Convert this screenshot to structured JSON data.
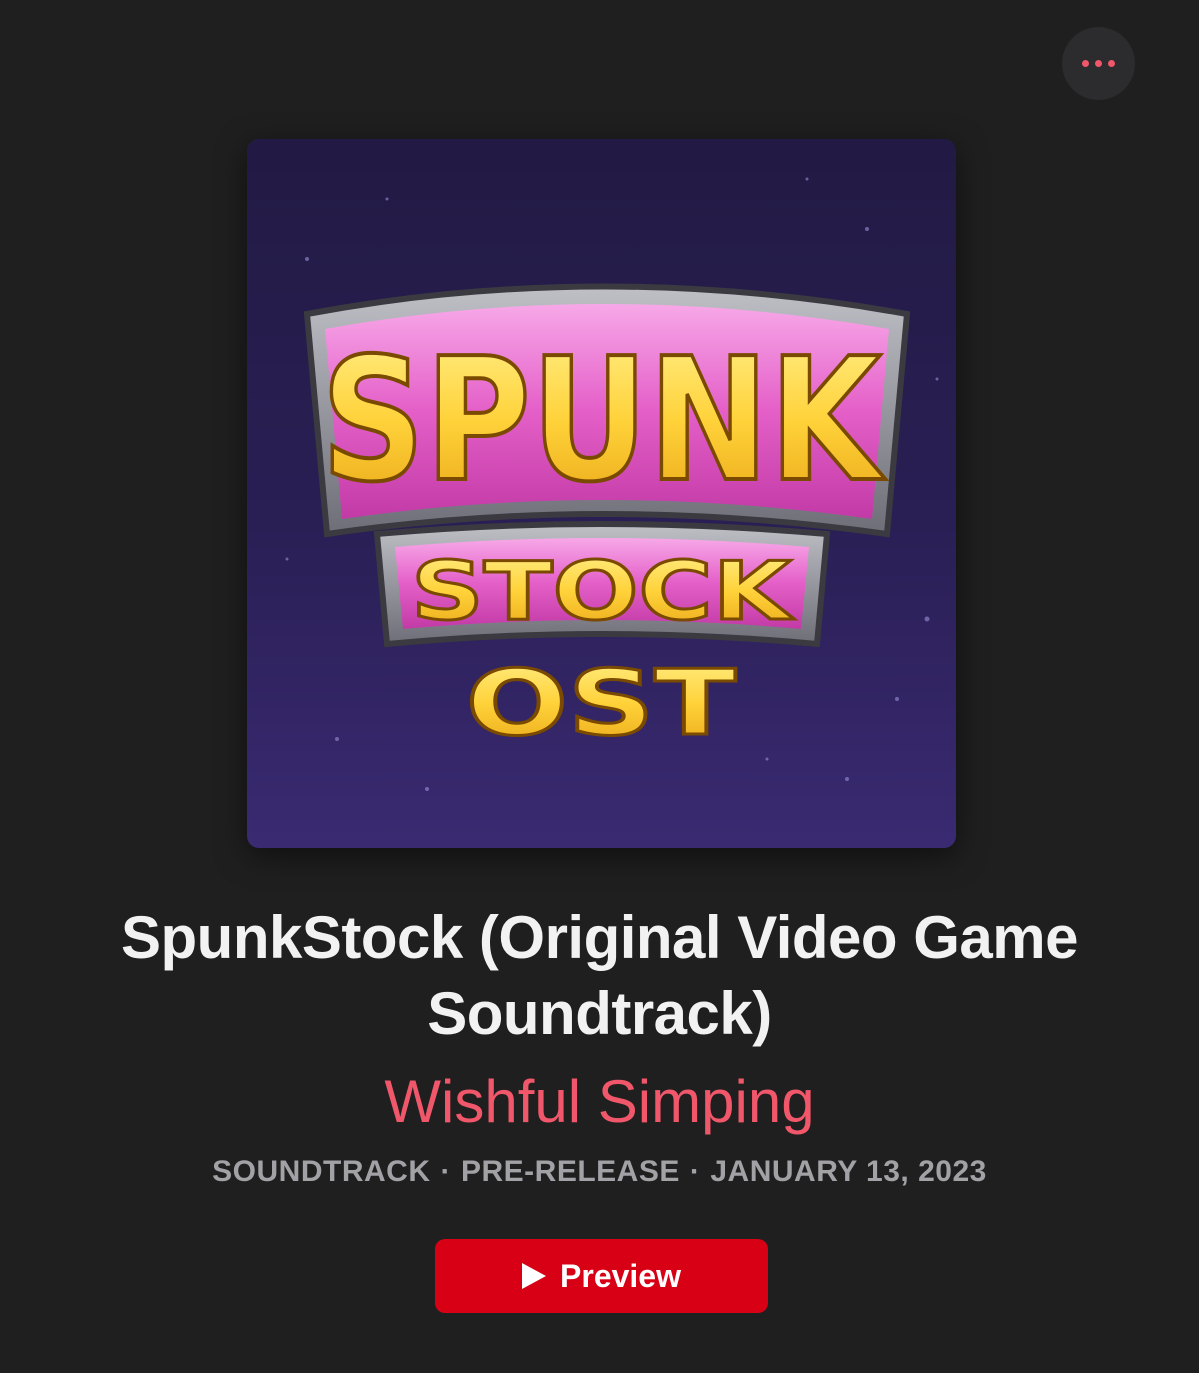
{
  "header": {
    "more_icon": "ellipsis-icon"
  },
  "album": {
    "artwork_text": {
      "line1": "SPUNK",
      "line2": "STOCK",
      "line3": "OST"
    },
    "title": "SpunkStock (Original Video Game Soundtrack)",
    "artist": "Wishful Simping",
    "genre": "SOUNDTRACK",
    "release_type": "PRE-RELEASE",
    "release_date": "JANUARY 13, 2023",
    "separator": "·"
  },
  "actions": {
    "preview_label": "Preview",
    "preview_icon": "play-icon"
  },
  "colors": {
    "accent": "#f0576a",
    "button_red": "#d70015",
    "background": "#1f1f1f",
    "meta_gray": "#a1a1a6"
  }
}
